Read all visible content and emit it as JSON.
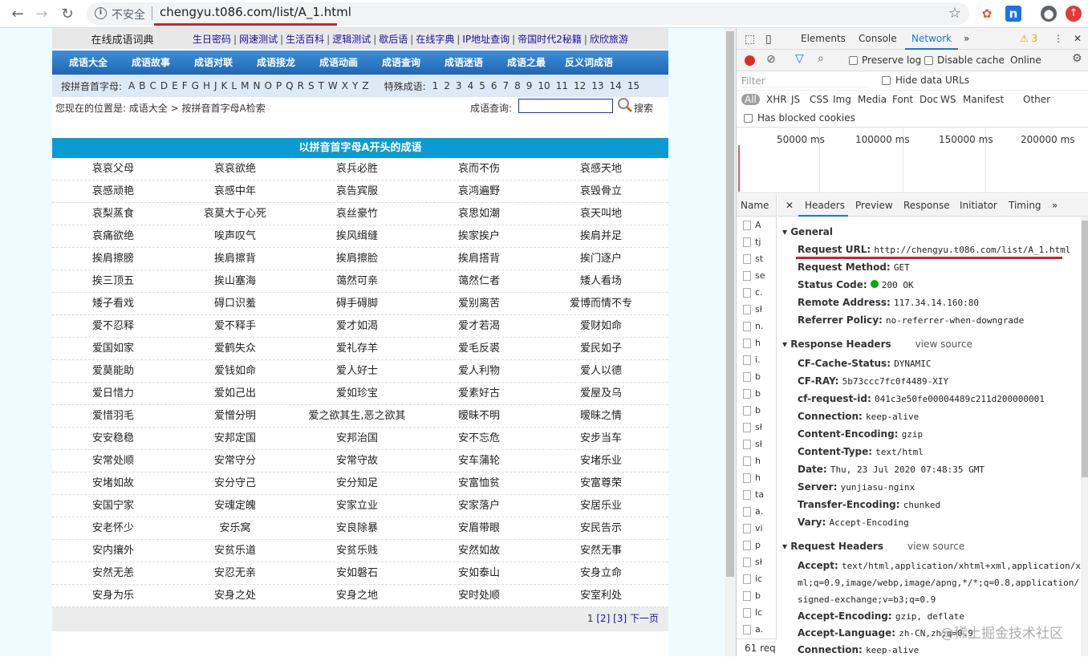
{
  "browser": {
    "security_text": "不安全",
    "url": "chengyu.t086.com/list/A_1.html",
    "back": "←",
    "forward": "→",
    "reload": "↻",
    "star": "☆",
    "warning_count": "3"
  },
  "site": {
    "title": "在线成语词典",
    "top_links": [
      "生日密码",
      "网速测试",
      "生活百科",
      "逻辑测试",
      "歇后语",
      "在线字典",
      "IP地址查询",
      "帝国时代2秘籍",
      "欣欣旅游"
    ],
    "menu": [
      "成语大全",
      "成语故事",
      "成语对联",
      "成语接龙",
      "成语动画",
      "成语查询",
      "成语迷语",
      "成语之最",
      "反义词成语"
    ],
    "letters_label": "按拼音首字母:",
    "letters": [
      "A",
      "B",
      "C",
      "D",
      "E",
      "F",
      "G",
      "H",
      "J",
      "K",
      "L",
      "M",
      "N",
      "O",
      "P",
      "Q",
      "R",
      "S",
      "T",
      "W",
      "X",
      "Y",
      "Z"
    ],
    "special_label": "特殊成语:",
    "special": [
      "1",
      "2",
      "3",
      "4",
      "5",
      "6",
      "7",
      "8",
      "9",
      "10",
      "11",
      "12",
      "13",
      "14",
      "15"
    ],
    "crumb": "您现在的位置是:  成语大全  >  按拼音首字母A检索",
    "search_label": "成语查询:",
    "search_btn": "搜索",
    "list_title": "以拼音首字母A开头的成语",
    "rows": [
      [
        "哀哀父母",
        "哀哀欲绝",
        "哀兵必胜",
        "哀而不伤",
        "哀感天地"
      ],
      [
        "哀感顽艳",
        "哀感中年",
        "哀告宾服",
        "哀鸿遍野",
        "哀毁骨立"
      ],
      [
        "哀梨蒸食",
        "哀莫大于心死",
        "哀丝豪竹",
        "哀思如潮",
        "哀天叫地"
      ],
      [
        "哀痛欲绝",
        "唉声叹气",
        "挨风缉缝",
        "挨家挨户",
        "挨肩并足"
      ],
      [
        "挨肩擦膀",
        "挨肩擦背",
        "挨肩擦脸",
        "挨肩搭背",
        "挨门逐户"
      ],
      [
        "挨三顶五",
        "挨山塞海",
        "蔼然可亲",
        "蔼然仁者",
        "矮人看场"
      ],
      [
        "矮子看戏",
        "碍口识羞",
        "碍手碍脚",
        "爱别离苦",
        "爱博而情不专"
      ],
      [
        "爱不忍释",
        "爱不释手",
        "爱才如渴",
        "爱才若渴",
        "爱财如命"
      ],
      [
        "爱国如家",
        "爱鹤失众",
        "爱礼存羊",
        "爱毛反裘",
        "爱民如子"
      ],
      [
        "爱莫能助",
        "爱钱如命",
        "爱人好士",
        "爱人利物",
        "爱人以德"
      ],
      [
        "爱日惜力",
        "爱如己出",
        "爱如珍宝",
        "爱素好古",
        "爱屋及乌"
      ],
      [
        "爱惜羽毛",
        "爱憎分明",
        "爱之欲其生,恶之欲其",
        "暧昧不明",
        "暧昧之情"
      ],
      [
        "安安稳稳",
        "安邦定国",
        "安邦治国",
        "安不忘危",
        "安步当车"
      ],
      [
        "安常处顺",
        "安常守分",
        "安常守故",
        "安车蒲轮",
        "安堵乐业"
      ],
      [
        "安堵如故",
        "安分守己",
        "安分知足",
        "安富恤贫",
        "安富尊荣"
      ],
      [
        "安国宁家",
        "安魂定魄",
        "安家立业",
        "安家落户",
        "安居乐业"
      ],
      [
        "安老怀少",
        "安乐窝",
        "安良除暴",
        "安眉带眼",
        "安民告示"
      ],
      [
        "安内攘外",
        "安贫乐道",
        "安贫乐贱",
        "安然如故",
        "安然无事"
      ],
      [
        "安然无恙",
        "安忍无亲",
        "安如磐石",
        "安如泰山",
        "安身立命"
      ],
      [
        "安身为乐",
        "安身之处",
        "安身之地",
        "安时处顺",
        "安室利处"
      ]
    ],
    "pager": {
      "current": "1",
      "p2": "[2]",
      "p3": "[3]",
      "next": "下一页"
    }
  },
  "devtools": {
    "tabs": [
      "Elements",
      "Console",
      "Network"
    ],
    "more": "»",
    "warn": "⚠ 3",
    "preserve_log": "Preserve log",
    "disable_cache": "Disable cache",
    "throttle": "Online",
    "filter_placeholder": "Filter",
    "hide_data_urls": "Hide data URLs",
    "types": [
      "All",
      "XHR",
      "JS",
      "CSS",
      "Img",
      "Media",
      "Font",
      "Doc",
      "WS",
      "Manifest",
      "Other"
    ],
    "blocked": "Has blocked cookies",
    "ticks": [
      "50000 ms",
      "100000 ms",
      "150000 ms",
      "200000 ms"
    ],
    "name_header": "Name",
    "names": [
      "A",
      "tj",
      "st",
      "se",
      "c.",
      "sł",
      "n.",
      "h",
      "i.",
      "b",
      "b",
      "b",
      "sł",
      "sł",
      "h",
      "h",
      "ta",
      "a.",
      "vi",
      "p",
      "sł",
      "ic",
      "b",
      "lc",
      "a."
    ],
    "footer": "61 req",
    "detail_tabs": [
      "Headers",
      "Preview",
      "Response",
      "Initiator",
      "Timing"
    ],
    "general_title": "▾ General",
    "general": [
      {
        "k": "Request URL:",
        "v": "http://chengyu.t086.com/list/A_1.html"
      },
      {
        "k": "Request Method:",
        "v": "GET"
      },
      {
        "k": "Status Code:",
        "v": "200 OK"
      },
      {
        "k": "Remote Address:",
        "v": "117.34.14.160:80"
      },
      {
        "k": "Referrer Policy:",
        "v": "no-referrer-when-downgrade"
      }
    ],
    "resp_title": "▾ Response Headers",
    "view_source": "view source",
    "resp": [
      {
        "k": "CF-Cache-Status:",
        "v": "DYNAMIC"
      },
      {
        "k": "CF-RAY:",
        "v": "5b73ccc7fc0f4489-XIY"
      },
      {
        "k": "cf-request-id:",
        "v": "041c3e50fe00004489c211d200000001"
      },
      {
        "k": "Connection:",
        "v": "keep-alive"
      },
      {
        "k": "Content-Encoding:",
        "v": "gzip"
      },
      {
        "k": "Content-Type:",
        "v": "text/html"
      },
      {
        "k": "Date:",
        "v": "Thu, 23 Jul 2020 07:48:35 GMT"
      },
      {
        "k": "Server:",
        "v": "yunjiasu-nginx"
      },
      {
        "k": "Transfer-Encoding:",
        "v": "chunked"
      },
      {
        "k": "Vary:",
        "v": "Accept-Encoding"
      }
    ],
    "req_title": "▾ Request Headers",
    "req": [
      {
        "k": "Accept:",
        "v": "text/html,application/xhtml+xml,application/x"
      },
      {
        "k": "",
        "v": "ml;q=0.9,image/webp,image/apng,*/*;q=0.8,application/"
      },
      {
        "k": "",
        "v": "signed-exchange;v=b3;q=0.9"
      },
      {
        "k": "Accept-Encoding:",
        "v": "gzip, deflate"
      },
      {
        "k": "Accept-Language:",
        "v": "zh-CN,zh;q=0.9"
      },
      {
        "k": "Connection:",
        "v": "keep-alive"
      }
    ]
  },
  "watermark": "@稀土掘金技术社区"
}
